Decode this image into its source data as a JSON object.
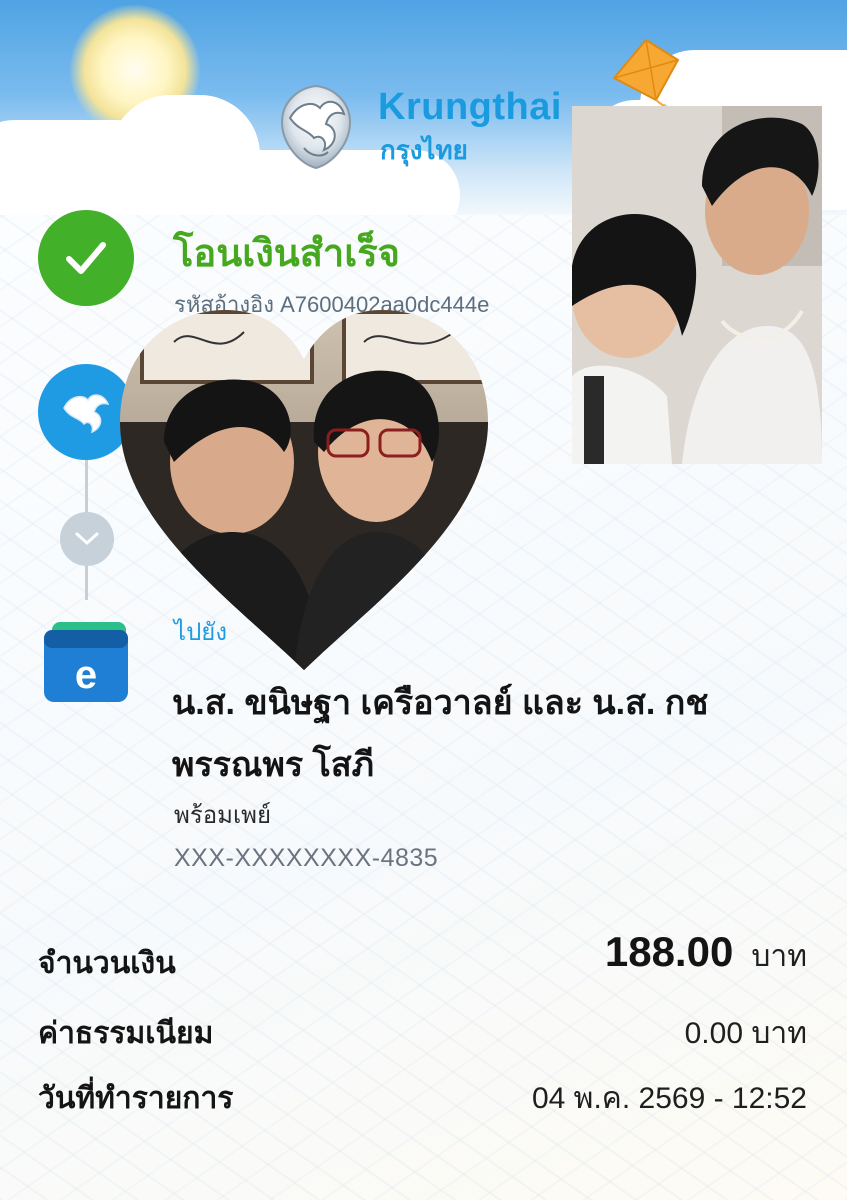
{
  "header": {
    "brand_en": "Krungthai",
    "brand_th": "กรุงไทย",
    "brand_color": "#1a9be0",
    "logo_icon": "krungthai-phoenix-logo",
    "decor": [
      "sun",
      "clouds",
      "kite"
    ]
  },
  "status": {
    "icon": "check-icon",
    "title": "โอนเงินสำเร็จ",
    "title_color": "#45a81e",
    "reference": "รหัสอ้างอิง A7600402aa0dc444e"
  },
  "recipient": {
    "to_label": "ไปยัง",
    "name_line1": "น.ส. ขนิษฐา เครือวาลย์ และ น.ส. กช",
    "name_line2": "พรรณพร โสภี",
    "channel": "พร้อมเพย์",
    "account": "XXX-XXXXXXXX-4835",
    "icon": "e-wallet-icon"
  },
  "summary": {
    "amount_label": "จำนวนเงิน",
    "amount_value": "188.00",
    "amount_unit": "บาท",
    "fee_label": "ค่าธรรมเนียม",
    "fee_value": "0.00 บาท",
    "date_label": "วันที่ทำรายการ",
    "date_value": "04 พ.ค. 2569 - 12:52"
  },
  "overlays": {
    "heart_photo": "photo-two-people-heart-frame",
    "rect_photo": "photo-two-people-selfie"
  }
}
